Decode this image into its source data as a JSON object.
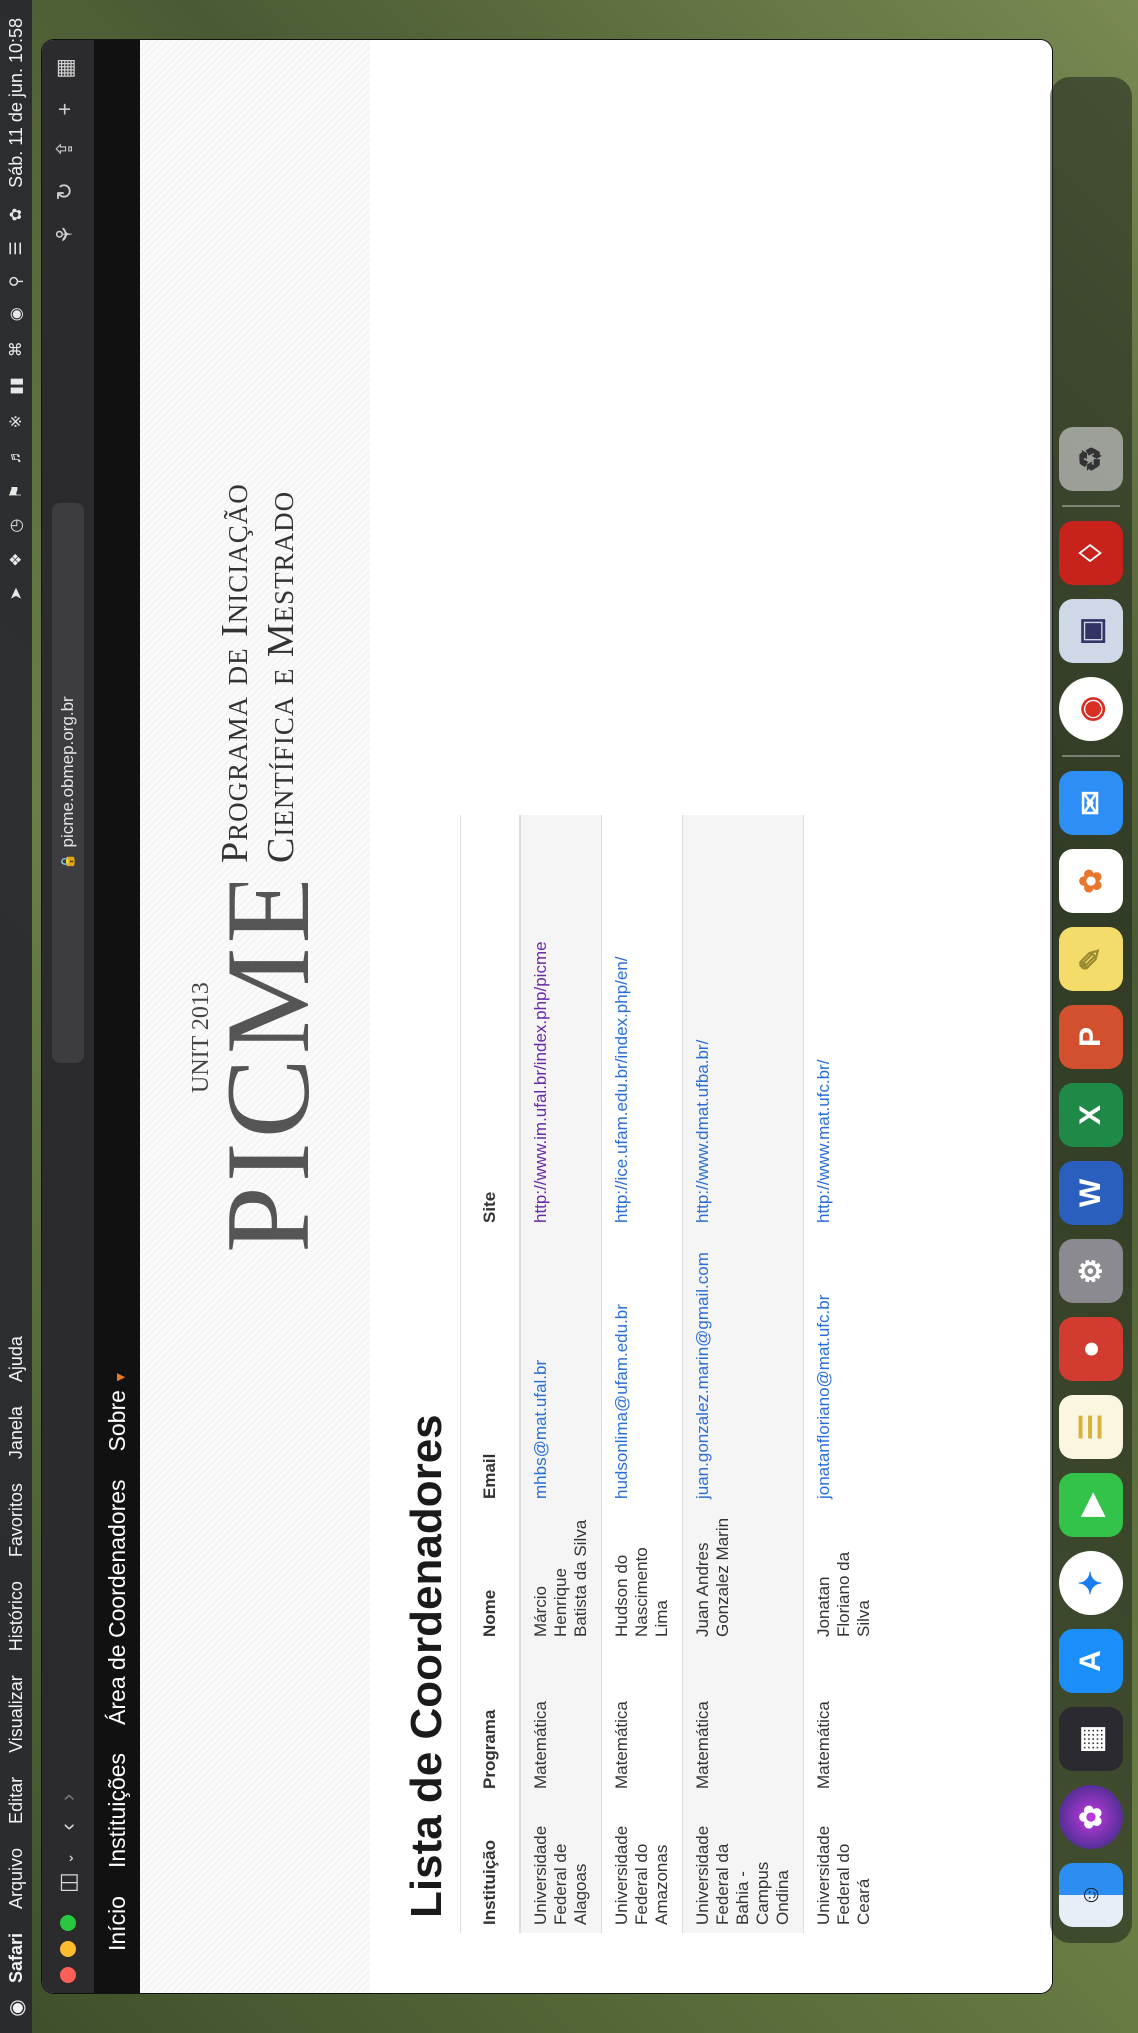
{
  "menubar": {
    "items": [
      "Safari",
      "Arquivo",
      "Editar",
      "Visualizar",
      "Histórico",
      "Favoritos",
      "Janela",
      "Ajuda"
    ],
    "clock": "Sáb. 11 de jun. 10:58",
    "status_icons": [
      "location-icon",
      "dropbox-icon",
      "clock-icon",
      "us-flag-icon",
      "volume-icon",
      "bluetooth-icon",
      "battery-icon",
      "wifi-icon",
      "user-icon",
      "search-icon",
      "control-center-icon",
      "siri-icon"
    ]
  },
  "browser": {
    "url": "picme.obmep.org.br"
  },
  "nav": {
    "items": [
      "Início",
      "Instituições",
      "Área de Coordenadores",
      "Sobre"
    ]
  },
  "header": {
    "logo_text": "PICME",
    "logo_mark": "UNIT 2013",
    "tagline_line1": "Programa de Iniciação",
    "tagline_line2": "Científica e Mestrado"
  },
  "page": {
    "title": "Lista de Coordenadores"
  },
  "table": {
    "headers": [
      "Instituição",
      "Programa",
      "Nome",
      "Email",
      "Site"
    ],
    "rows": [
      {
        "inst": "Universidade Federal de Alagoas",
        "prog": "Matemática",
        "nome": "Márcio Henrique Batista da Silva",
        "email": "mhbs@mat.ufal.br",
        "site": "http://www.im.ufal.br/index.php/picme"
      },
      {
        "inst": "Universidade Federal do Amazonas",
        "prog": "Matemática",
        "nome": "Hudson do Nascimento Lima",
        "email": "hudsonlima@ufam.edu.br",
        "site": "http://ice.ufam.edu.br/index.php/en/"
      },
      {
        "inst": "Universidade Federal da Bahia - Campus Ondina",
        "prog": "Matemática",
        "nome": "Juan Andres Gonzalez Marin",
        "email": "juan.gonzalez.marin@gmail.com",
        "site": "http://www.dmat.ufba.br/"
      },
      {
        "inst": "Universidade Federal do Ceará",
        "prog": "Matemática",
        "nome": "Jonatan Floriano da Silva",
        "email": "jonatanfloriano@mat.ufc.br",
        "site": "http://www.mat.ufc.br/"
      }
    ]
  },
  "dock": {
    "apps": [
      "finder-icon",
      "siri-icon",
      "launchpad-icon",
      "app-store-icon",
      "safari-icon",
      "facetime-icon",
      "notes-icon",
      "photo-booth-icon",
      "system-preferences-icon",
      "word-icon",
      "excel-icon",
      "powerpoint-icon",
      "stickies-icon",
      "photos-icon",
      "mail-icon",
      "chrome-icon",
      "preview-icon",
      "acrobat-icon",
      "trash-icon"
    ],
    "labels": {
      "word": "W",
      "excel": "X",
      "powerpoint": "P"
    }
  }
}
